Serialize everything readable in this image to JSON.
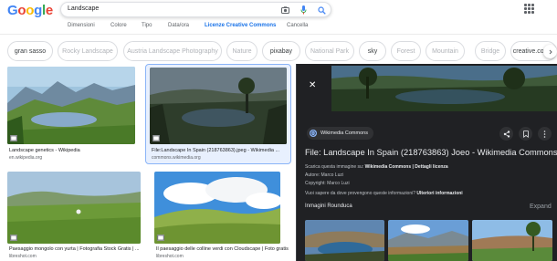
{
  "header": {
    "logo_letters": [
      "G",
      "o",
      "o",
      "g",
      "l",
      "e"
    ],
    "logo_colors": [
      "#4285f4",
      "#ea4335",
      "#fbbc05",
      "#4285f4",
      "#34a853",
      "#ea4335"
    ],
    "search_value": "Landscape",
    "icons": [
      "camera-icon",
      "mic-icon",
      "search-icon",
      "apps-icon"
    ]
  },
  "tools": [
    "Dimensioni",
    "Colore",
    "Tipo",
    "Data/ora",
    "Licenze Creative Commons",
    "Cancella"
  ],
  "chips": [
    "gran sasso",
    "Rocky Landscape",
    "Austria Landscape Photography",
    "Nature",
    "pixabay",
    "National Park",
    "sky",
    "Forest",
    "Mountain",
    "Bridge",
    "creative.comm"
  ],
  "results": [
    {
      "title": "Landscape genetics - Wikipedia",
      "source": "en.wikipedia.org"
    },
    {
      "title": "File:Landscape In Spain (218763863).jpeg - Wikimedia ...",
      "source": "commons.wikimedia.org"
    },
    {
      "title": "Paesaggio mongolo con yurta | Fotografia Stock Gratis | ...",
      "source": "libreshot.com"
    },
    {
      "title": "Il paesaggio delle colline verdi con Cloudscape | Foto gratis",
      "source": "libreshot.com"
    }
  ],
  "viewer": {
    "close_symbol": "✕",
    "source_name": "Wikimedia Commons",
    "title": "File: Landscape In Spain (218763863) Joeo - Wikimedia Commons",
    "line1_prefix": "Scarica questa immagine su:",
    "line1_link1": "Wikimedia Commons",
    "line1_link2": "| Dettagli licenza",
    "line2": "Autore: Marco Luzi",
    "line3": "Copyright: Marco Luzi",
    "line4_prefix": "Vuoi sapere da dove provengono queste informazioni?",
    "line4_link": "Ulteriori informazioni",
    "more_label": "Inmagini Rounduca",
    "expand_label": "Expand"
  },
  "colors": {
    "accent": "#1a73e8",
    "viewer_bg": "#202124",
    "selected_border": "#8ab4f8"
  }
}
